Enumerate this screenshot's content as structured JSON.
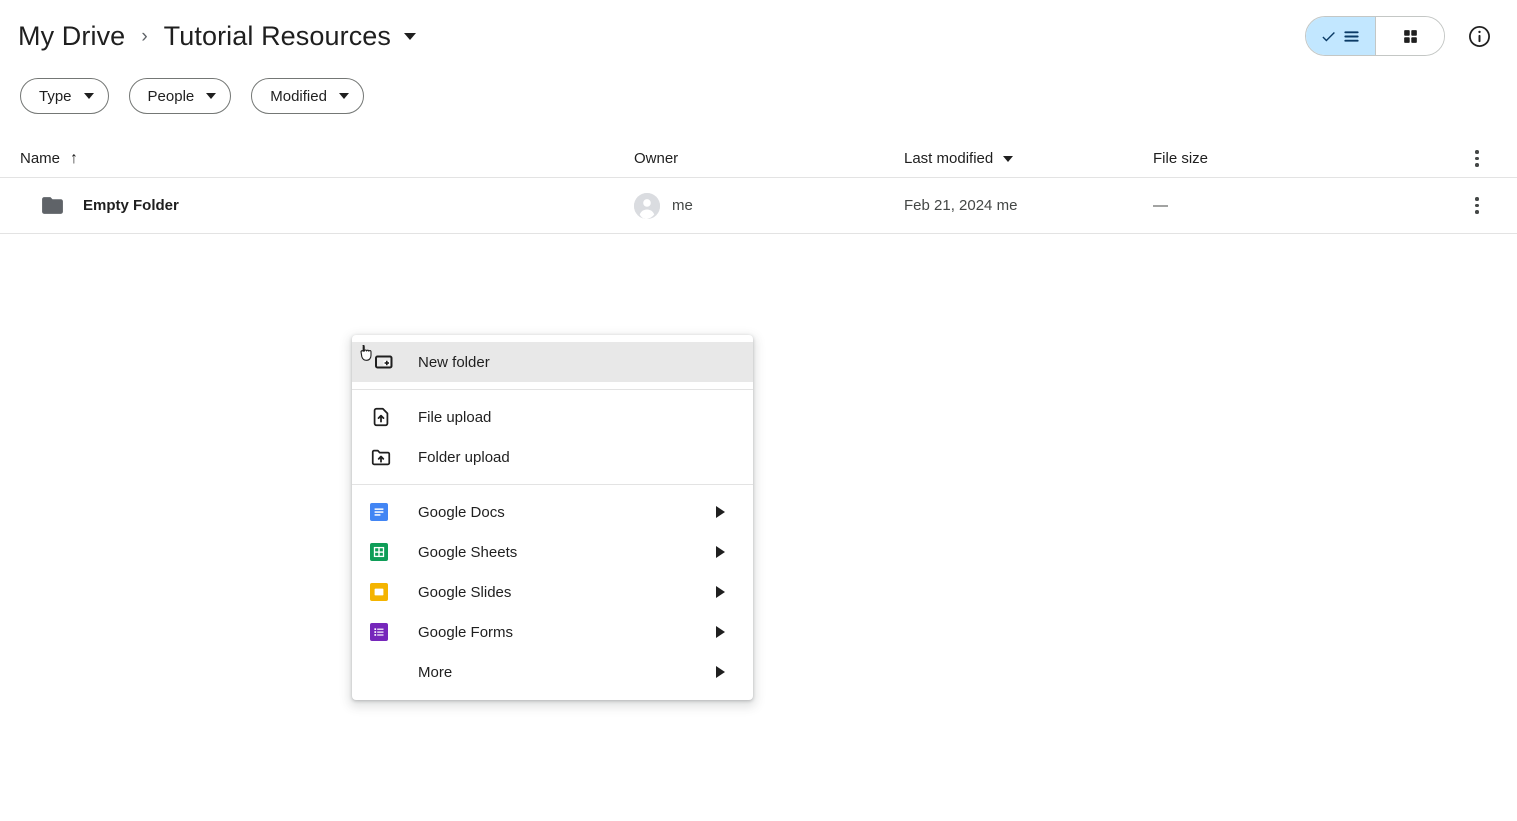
{
  "header": {
    "breadcrumb": {
      "root": "My Drive",
      "separator": "›",
      "current": "Tutorial Resources"
    },
    "view_toggle": {
      "list_label": "list-view",
      "grid_label": "grid-view",
      "active": "list"
    },
    "info_label": "Details"
  },
  "filters": [
    {
      "label": "Type"
    },
    {
      "label": "People"
    },
    {
      "label": "Modified"
    }
  ],
  "table": {
    "columns": {
      "name": "Name",
      "owner": "Owner",
      "last_modified": "Last modified",
      "file_size": "File size"
    },
    "sort": {
      "column": "Name",
      "direction_glyph": "↑"
    },
    "rows": [
      {
        "name": "Empty Folder",
        "icon": "folder-icon",
        "owner": "me",
        "last_modified": "Feb 21, 2024 me",
        "file_size": "—"
      }
    ]
  },
  "context_menu": {
    "items": [
      {
        "label": "New folder",
        "icon": "new-folder-icon",
        "highlighted": true,
        "submenu": false
      },
      {
        "label": "File upload",
        "icon": "file-upload-icon",
        "highlighted": false,
        "submenu": false
      },
      {
        "label": "Folder upload",
        "icon": "folder-upload-icon",
        "highlighted": false,
        "submenu": false
      },
      {
        "label": "Google Docs",
        "icon": "google-docs-icon",
        "highlighted": false,
        "submenu": true
      },
      {
        "label": "Google Sheets",
        "icon": "google-sheets-icon",
        "highlighted": false,
        "submenu": true
      },
      {
        "label": "Google Slides",
        "icon": "google-slides-icon",
        "highlighted": false,
        "submenu": true
      },
      {
        "label": "Google Forms",
        "icon": "google-forms-icon",
        "highlighted": false,
        "submenu": true
      },
      {
        "label": "More",
        "icon": "none",
        "highlighted": false,
        "submenu": true
      }
    ]
  },
  "colors": {
    "active_toggle": "#c2e7ff",
    "docs_blue": "#4285f4",
    "sheets_green": "#0f9d58",
    "slides_amber": "#f4b400",
    "forms_purple": "#7627bb",
    "folder_gray": "#5f6368",
    "highlight_gray": "#e8e8e8"
  }
}
